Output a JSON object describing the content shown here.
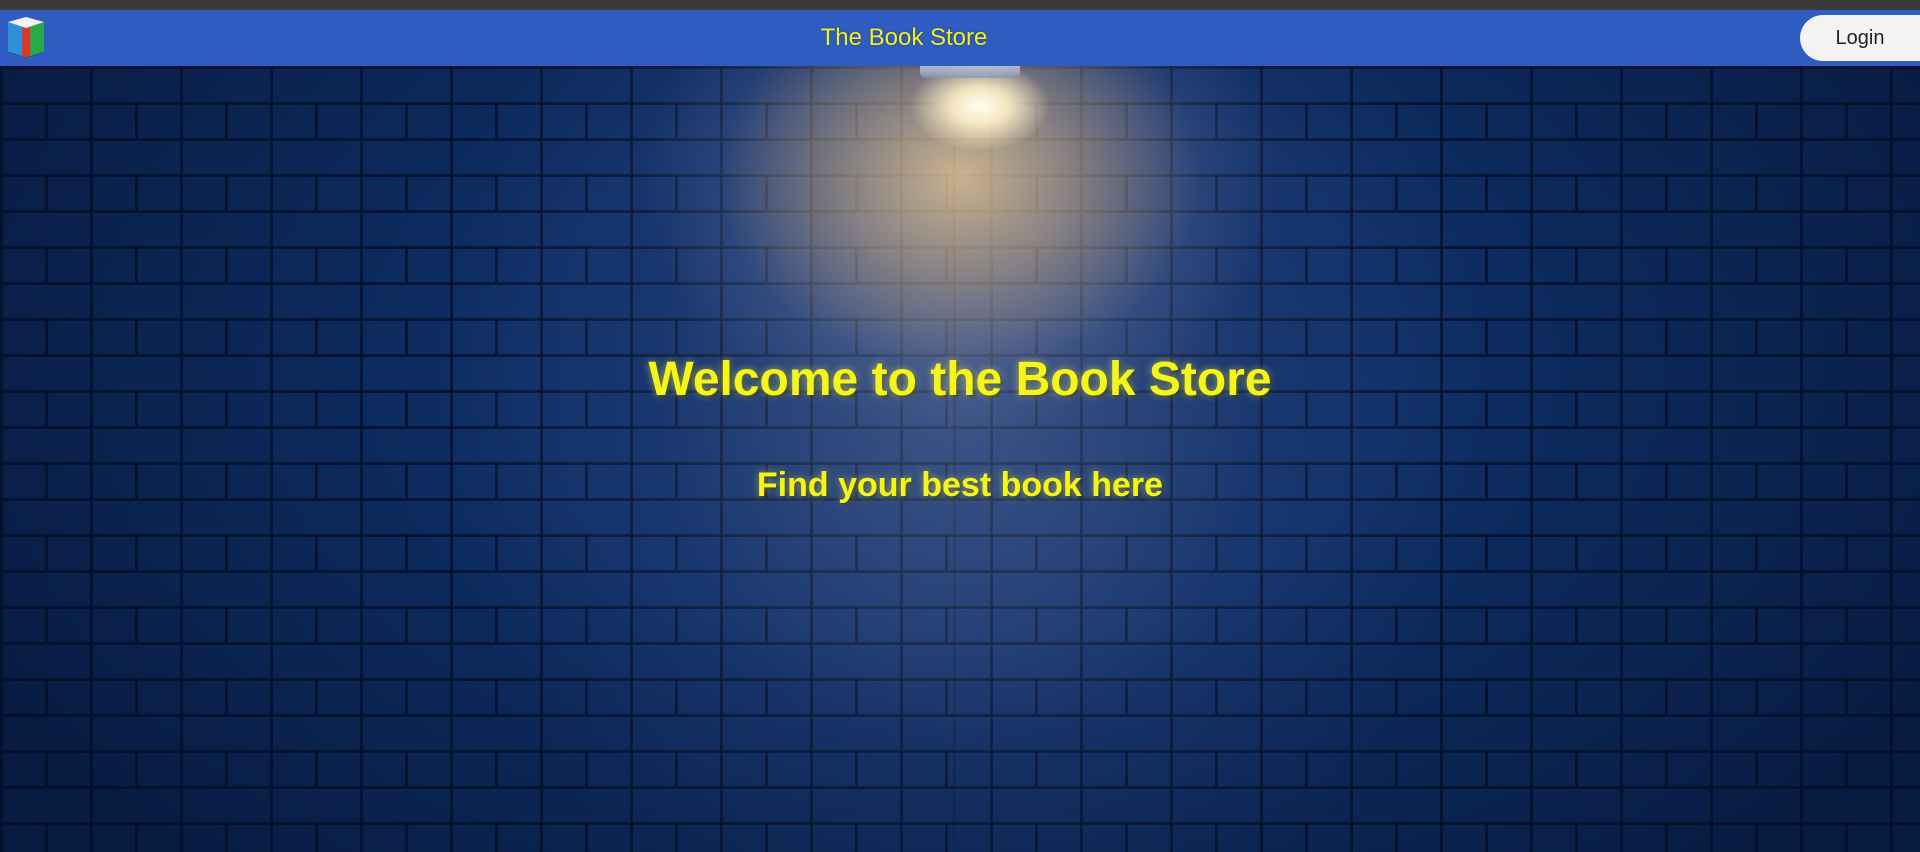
{
  "navbar": {
    "title": "The Book Store",
    "login_label": "Login",
    "logo_icon": "book-icon"
  },
  "hero": {
    "title": "Welcome to the Book Store",
    "subtitle": "Find your best book here"
  },
  "colors": {
    "navbar_bg": "#2f5cc0",
    "accent_text": "#f5f51a",
    "wall": "#0f2f66"
  }
}
